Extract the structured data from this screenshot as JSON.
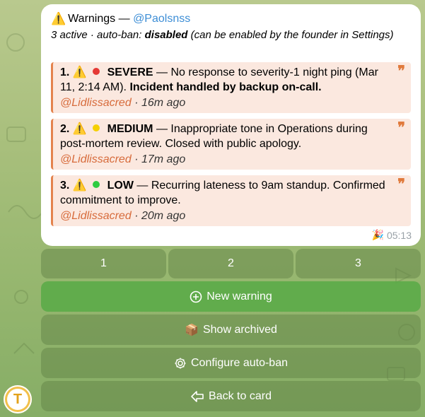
{
  "message": {
    "title_icon": "warning-icon",
    "title": "Warnings",
    "title_separator": "—",
    "mention": "@Paolsnss",
    "active_count": "3 active",
    "sep": "·",
    "autoban_prefix": "auto-ban:",
    "autoban_state": "disabled",
    "autoban_note": "(can be enabled by the founder in Settings)",
    "time": "05:13",
    "reaction_icon": "party-popper-icon"
  },
  "warnings": [
    {
      "number": "1.",
      "severity": "SEVERE",
      "severity_color": "#e53935",
      "text": "— No response to severity-1 night ping (Mar 11, 2:14 AM).",
      "bold_text": "Incident handled by backup on-call.",
      "author": "@Lidlissacred",
      "ago": "16m ago"
    },
    {
      "number": "2.",
      "severity": "MEDIUM",
      "severity_color": "#f5d000",
      "text": "— Inappropriate tone in Operations during post-mortem review. Closed with public apology.",
      "bold_text": "",
      "author": "@Lidlissacred",
      "ago": "17m ago"
    },
    {
      "number": "3.",
      "severity": "LOW",
      "severity_color": "#2ecc40",
      "text": "— Recurring lateness to 9am standup. Confirmed commitment to improve.",
      "bold_text": "",
      "author": "@Lidlissacred",
      "ago": "20m ago"
    }
  ],
  "keyboard": {
    "pages": [
      "1",
      "2",
      "3"
    ],
    "new_warning": "New warning",
    "show_archived": "Show archived",
    "configure_autoban": "Configure auto-ban",
    "back_to_card": "Back to card"
  }
}
